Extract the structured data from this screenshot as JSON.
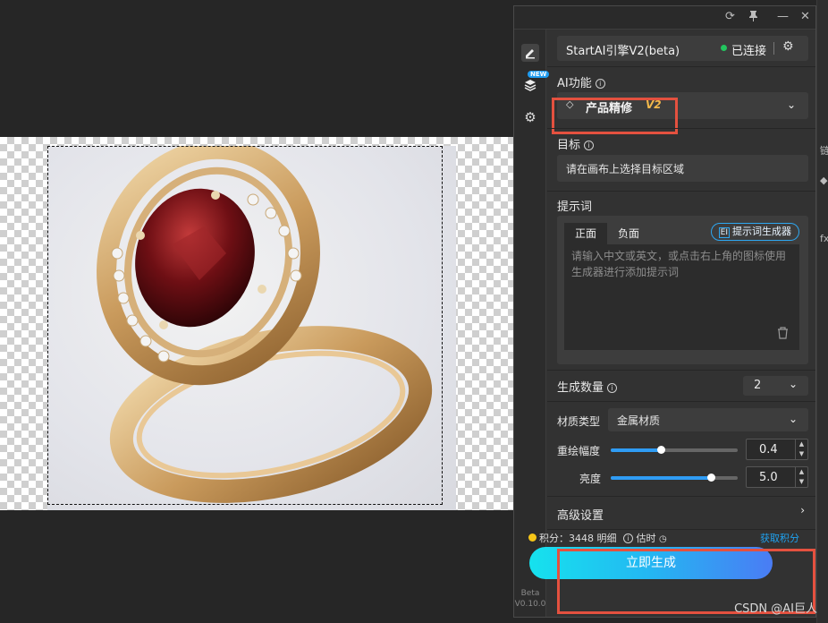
{
  "panel": {
    "controls": {
      "refresh": "⟳",
      "pin": "📌",
      "minimize": "—",
      "close": "✕"
    },
    "rail": {
      "new_badge": "NEW",
      "version_line1": "Beta",
      "version_line2": "V0.10.0"
    },
    "engine": {
      "name": "StartAI引擎V2(beta)",
      "status": "已连接",
      "status_color": "#22c55e"
    },
    "ai_function": {
      "label": "AI功能",
      "value": "产品精修",
      "version_tag": "V2"
    },
    "target": {
      "label": "目标",
      "value": "请在画布上选择目标区域"
    },
    "prompt": {
      "label": "提示词",
      "tab_positive": "正面",
      "tab_negative": "负面",
      "generator_button": "提示词生成器",
      "placeholder": "请输入中文或英文，或点击右上角的图标使用生成器进行添加提示词"
    },
    "count": {
      "label": "生成数量",
      "value": "2"
    },
    "material": {
      "label": "材质类型",
      "value": "金属材质"
    },
    "redraw": {
      "label": "重绘幅度",
      "value": "0.4",
      "fraction": 0.4
    },
    "brightness": {
      "label": "亮度",
      "value": "5.0",
      "fraction": 0.8
    },
    "advanced": {
      "label": "高级设置"
    },
    "credits": {
      "text": "积分：3448 明细",
      "estimate": "估时",
      "get": "获取积分"
    },
    "generate_button": "立即生成"
  },
  "watermark": "CSDN @AI巨人",
  "accent": "#2f9cf4",
  "highlight_color": "#e4513f"
}
